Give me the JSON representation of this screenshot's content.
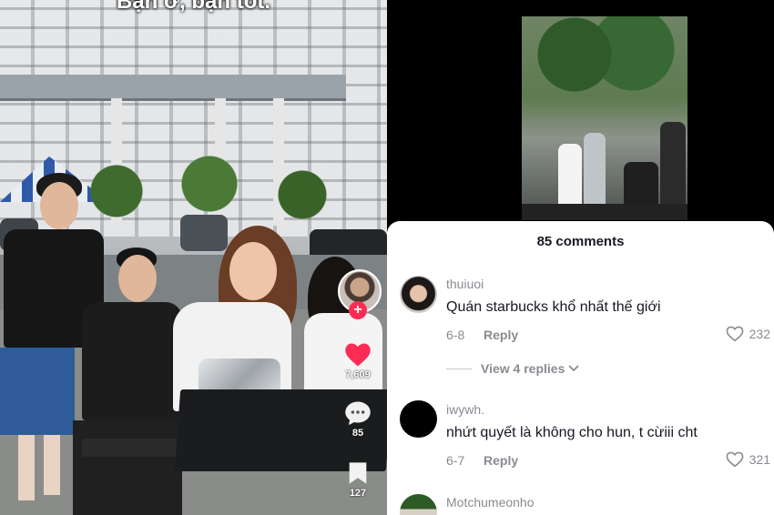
{
  "video": {
    "caption_overlay": "Bạn ơ, bạn tốt.",
    "actions": {
      "likes": "7,609",
      "comments": "85",
      "saves": "127",
      "follow_symbol": "+"
    }
  },
  "comments_panel": {
    "title": "85 comments",
    "items": [
      {
        "username": "thuiuoi",
        "text": "Quán starbucks khổ nhất thế giới",
        "date": "6-8",
        "reply_label": "Reply",
        "likes": "232",
        "view_replies": "View 4 replies"
      },
      {
        "username": "iwywh.",
        "text": "nhứt quyết là không cho hun, t cừiii cht",
        "date": "6-7",
        "reply_label": "Reply",
        "likes": "321"
      },
      {
        "username": "Motchumeonho"
      }
    ]
  },
  "colors": {
    "like_red": "#fe2c55",
    "text_primary": "#161823",
    "text_secondary": "#8a8b91"
  }
}
